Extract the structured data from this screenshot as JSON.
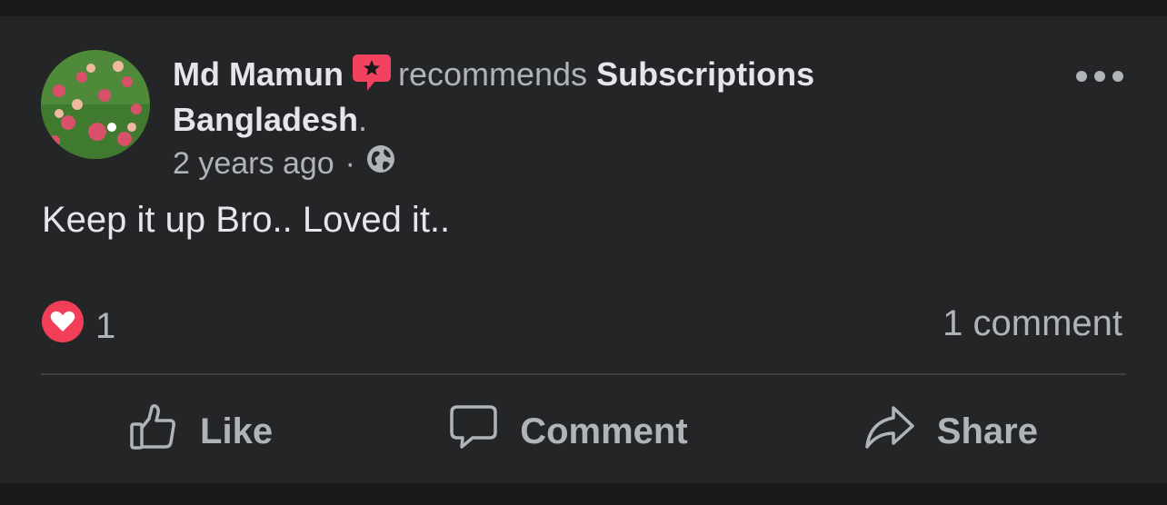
{
  "post": {
    "author": "Md Mamun",
    "verb": "recommends",
    "page_name": "Subscriptions Bangladesh",
    "period": ".",
    "time": "2 years ago",
    "separator": "·",
    "privacy_icon": "globe-icon",
    "text": "Keep it up Bro.. Loved it.."
  },
  "stats": {
    "reaction_icon": "love-reaction-icon",
    "reaction_count": "1",
    "comments": "1 comment"
  },
  "actions": {
    "like": "Like",
    "comment": "Comment",
    "share": "Share"
  },
  "colors": {
    "background": "#242526",
    "primary_text": "#e4e6eb",
    "secondary_text": "#b0b3b8",
    "recommend_badge": "#f3425f",
    "love": "#f33e58"
  }
}
